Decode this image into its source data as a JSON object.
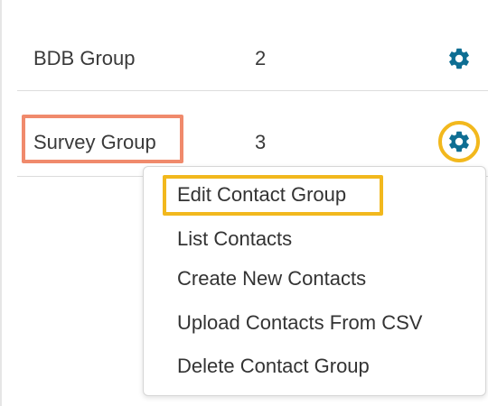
{
  "groups": [
    {
      "name": "BDB Group",
      "count": "2",
      "icon": "gear-icon"
    },
    {
      "name": "Survey Group",
      "count": "3",
      "icon": "gear-icon"
    }
  ],
  "menu": {
    "items": [
      "Edit Contact Group",
      "List Contacts",
      "Create New Contacts",
      "Upload Contacts From CSV",
      "Delete Contact Group"
    ]
  },
  "colors": {
    "gear": "#0e6e93",
    "highlight_name": "#f08a6c",
    "highlight_action": "#f2b81d"
  }
}
